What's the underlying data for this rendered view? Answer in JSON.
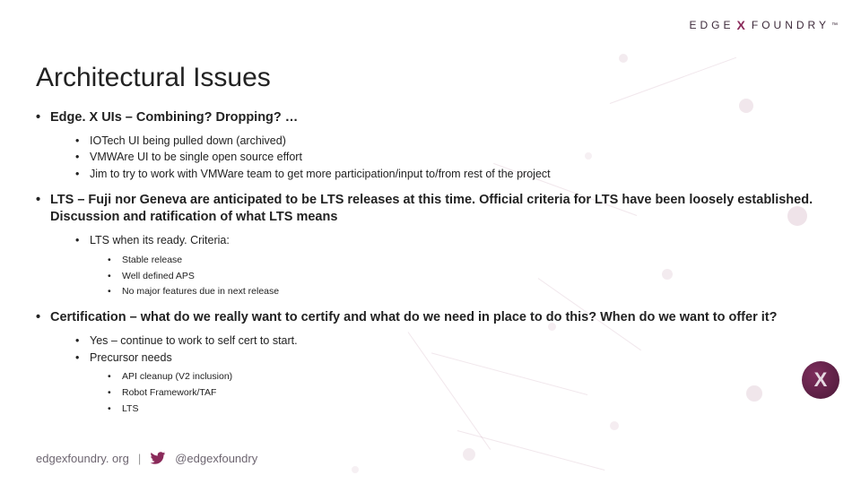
{
  "brand": {
    "left": "EDGE",
    "x": "X",
    "right": "FOUNDRY",
    "tm": "™"
  },
  "title": "Architectural Issues",
  "bullets": [
    {
      "text": "Edge. X UIs – Combining? Dropping? …",
      "children": [
        {
          "text": "IOTech UI being pulled down (archived)"
        },
        {
          "text": "VMWAre UI to be single open source effort"
        },
        {
          "text": "Jim to try to work with VMWare team to get more participation/input to/from rest of the project"
        }
      ]
    },
    {
      "text": "LTS – Fuji nor Geneva are anticipated to be LTS releases at this time.  Official criteria for LTS have been loosely established.  Discussion and ratification of what LTS means",
      "children": [
        {
          "text": "LTS when its ready.  Criteria:",
          "children": [
            {
              "text": "Stable release"
            },
            {
              "text": "Well defined APS"
            },
            {
              "text": "No major features due in next release"
            }
          ]
        }
      ]
    },
    {
      "text": "Certification – what do we really want to certify and what do we need in place to do this?  When do we want to offer it?",
      "children": [
        {
          "text": "Yes – continue to work to self cert to start."
        },
        {
          "text": "Precursor needs",
          "children": [
            {
              "text": "API cleanup (V2 inclusion)"
            },
            {
              "text": "Robot Framework/TAF"
            },
            {
              "text": "LTS"
            }
          ]
        }
      ]
    }
  ],
  "footer": {
    "site": "edgexfoundry. org",
    "sep": "|",
    "handle": "@edgexfoundry"
  },
  "badge": {
    "glyph": "X"
  }
}
